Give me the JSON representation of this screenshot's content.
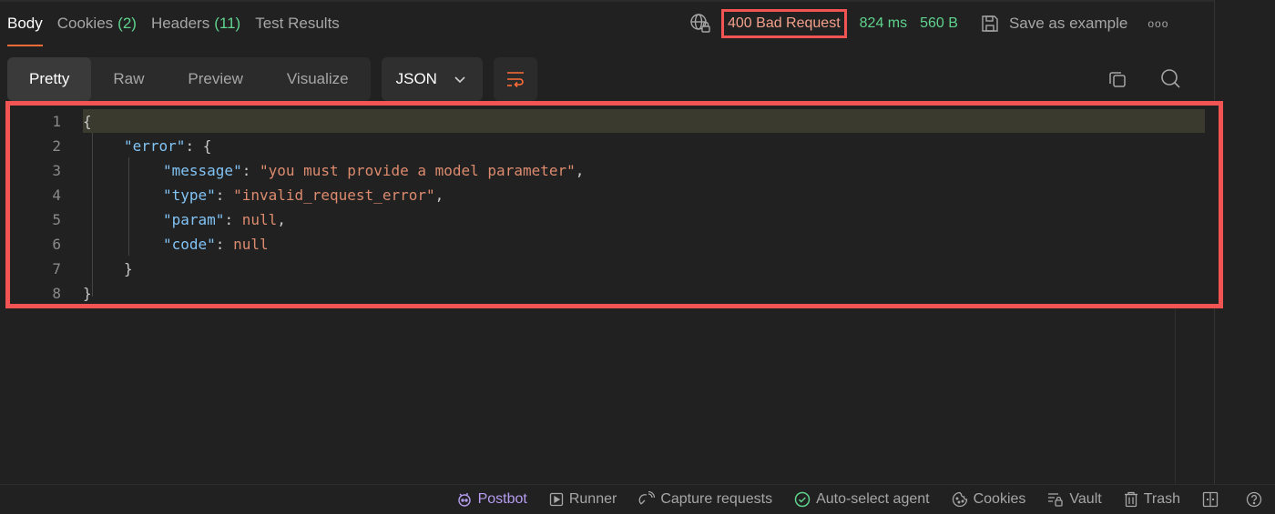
{
  "response_tabs": [
    {
      "label": "Body",
      "count": null,
      "active": true
    },
    {
      "label": "Cookies",
      "count": "(2)",
      "active": false
    },
    {
      "label": "Headers",
      "count": "(11)",
      "active": false
    },
    {
      "label": "Test Results",
      "count": null,
      "active": false
    }
  ],
  "status": {
    "code_text": "400 Bad Request",
    "time": "824 ms",
    "size": "560 B",
    "save_label": "Save as example",
    "more_label": "ooo"
  },
  "toolbar": {
    "views": [
      "Pretty",
      "Raw",
      "Preview",
      "Visualize"
    ],
    "active_view": "Pretty",
    "language": "JSON"
  },
  "editor": {
    "lines": [
      {
        "num": "1",
        "text": "{"
      },
      {
        "num": "2",
        "key": "\"error\"",
        "rest": ": {"
      },
      {
        "num": "3",
        "key": "\"message\"",
        "value": "\"you must provide a model parameter\"",
        "tail": ","
      },
      {
        "num": "4",
        "key": "\"type\"",
        "value": "\"invalid_request_error\"",
        "tail": ","
      },
      {
        "num": "5",
        "key": "\"param\"",
        "value": "null",
        "tail": ","
      },
      {
        "num": "6",
        "key": "\"code\"",
        "value": "null",
        "tail": ""
      },
      {
        "num": "7",
        "text": "}"
      },
      {
        "num": "8",
        "text": "}"
      }
    ]
  },
  "footer": {
    "postbot": "Postbot",
    "runner": "Runner",
    "capture": "Capture requests",
    "auto_select": "Auto-select agent",
    "cookies": "Cookies",
    "vault": "Vault",
    "trash": "Trash"
  },
  "colors": {
    "accent": "#ff6c37",
    "error_status": "#f3a18b",
    "success_metric": "#5fd38d",
    "highlight_border": "#f25454",
    "json_key": "#82c3f5",
    "json_value": "#dd8b6e",
    "postbot": "#b59cf0"
  }
}
